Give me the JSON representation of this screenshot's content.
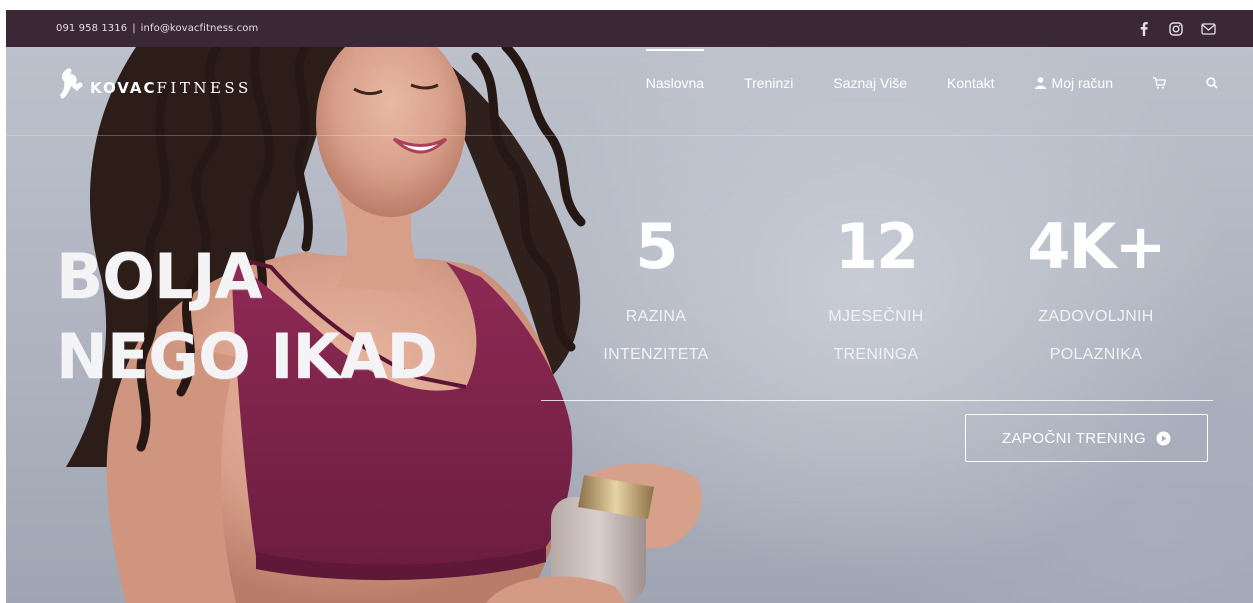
{
  "topbar": {
    "phone": "091 958 1316",
    "separator": "|",
    "email": "info@kovacfitness.com",
    "social": [
      {
        "icon": "facebook-icon"
      },
      {
        "icon": "instagram-icon"
      },
      {
        "icon": "mail-icon"
      }
    ]
  },
  "logo": {
    "text_part1": "KOVAC",
    "text_part2": "FITNESS"
  },
  "nav": {
    "items": [
      {
        "label": "Naslovna",
        "active": true
      },
      {
        "label": "Treninzi"
      },
      {
        "label": "Saznaj Više"
      },
      {
        "label": "Kontakt"
      },
      {
        "label": "Moj račun",
        "icon": "user-icon"
      }
    ],
    "cart_icon": "cart-icon",
    "search_icon": "search-icon"
  },
  "hero": {
    "headline_line1": "BOLJA",
    "headline_line2": "NEGO IKAD",
    "stats": [
      {
        "value": "5",
        "label_line1": "RAZINA",
        "label_line2": "INTENZITETA"
      },
      {
        "value": "12",
        "label_line1": "MJESEČNIH",
        "label_line2": "TRENINGA"
      },
      {
        "value": "4K+",
        "label_line1": "ZADOVOLJNIH",
        "label_line2": "POLAZNIKA"
      }
    ],
    "cta_label": "ZAPOČNI TRENING"
  },
  "colors": {
    "topbar_bg": "#3b2837",
    "accent_top": "#8a2350",
    "text": "#ffffff"
  }
}
